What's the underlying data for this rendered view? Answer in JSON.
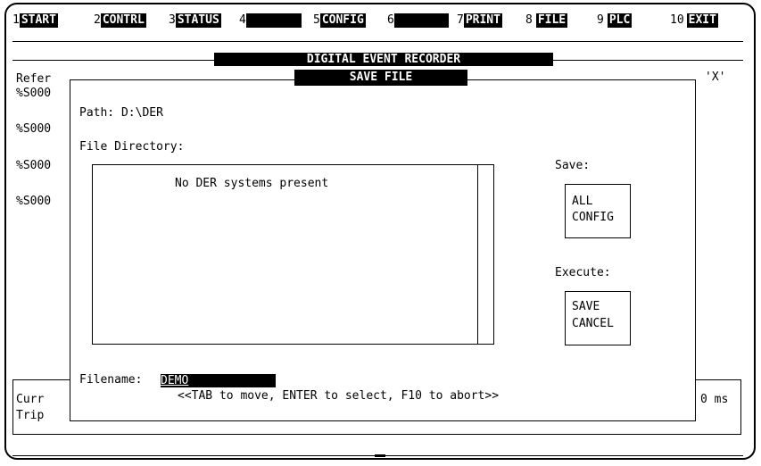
{
  "function_keys": [
    {
      "num": "1",
      "label": "START"
    },
    {
      "num": "2",
      "label": "CONTRL"
    },
    {
      "num": "3",
      "label": "STATUS"
    },
    {
      "num": "4",
      "label": ""
    },
    {
      "num": "5",
      "label": "CONFIG"
    },
    {
      "num": "6",
      "label": ""
    },
    {
      "num": "7",
      "label": "PRINT"
    },
    {
      "num": "8",
      "label": "FILE"
    },
    {
      "num": "9",
      "label": "PLC"
    },
    {
      "num": "10",
      "label": "EXIT"
    }
  ],
  "background": {
    "title": "DIGITAL EVENT RECORDER",
    "refer_label": "Refer",
    "x_label": "'X'",
    "s_items": [
      "%S000",
      "%S000",
      "%S000",
      "%S000"
    ],
    "curr_label": "Curr",
    "trip_label": "Trip",
    "ms_label": "0 ms"
  },
  "dialog": {
    "title": "SAVE FILE",
    "path_label": "Path: D:\\DER",
    "directory_label": "File Directory:",
    "directory_empty_text": "No DER systems present",
    "save_label": "Save:",
    "save_button_line1": "ALL",
    "save_button_line2": "CONFIG",
    "execute_label": "Execute:",
    "execute_button_line1": "SAVE",
    "execute_button_line2": "CANCEL",
    "filename_label": "Filename:",
    "filename_value": "DEMO",
    "hint": "<<TAB to move, ENTER to select, F10 to abort>>"
  }
}
